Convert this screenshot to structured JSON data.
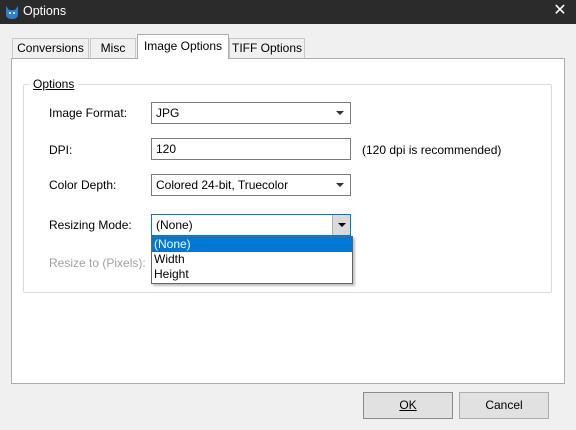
{
  "window": {
    "title": "Options",
    "close_glyph": "✕"
  },
  "tabs": [
    {
      "label": "Conversions",
      "active": false
    },
    {
      "label": "Misc",
      "active": false
    },
    {
      "label": "Image Options",
      "active": true
    },
    {
      "label": "TIFF Options",
      "active": false
    }
  ],
  "options_group": {
    "title": "Options",
    "image_format": {
      "label": "Image Format:",
      "value": "JPG"
    },
    "dpi": {
      "label": "DPI:",
      "value": "120",
      "hint": "(120 dpi is recommended)"
    },
    "color_depth": {
      "label": "Color Depth:",
      "value": "Colored 24-bit, Truecolor"
    },
    "resizing_mode": {
      "label": "Resizing Mode:",
      "value": "(None)",
      "options": [
        "(None)",
        "Width",
        "Height"
      ],
      "selected_index": 0
    },
    "resize_to": {
      "label": "Resize to (Pixels):"
    }
  },
  "buttons": {
    "ok": "OK",
    "cancel": "Cancel"
  },
  "colors": {
    "titlebar": "#2b2b2b",
    "accent": "#0078d7",
    "icon": "#2f7fd1"
  }
}
